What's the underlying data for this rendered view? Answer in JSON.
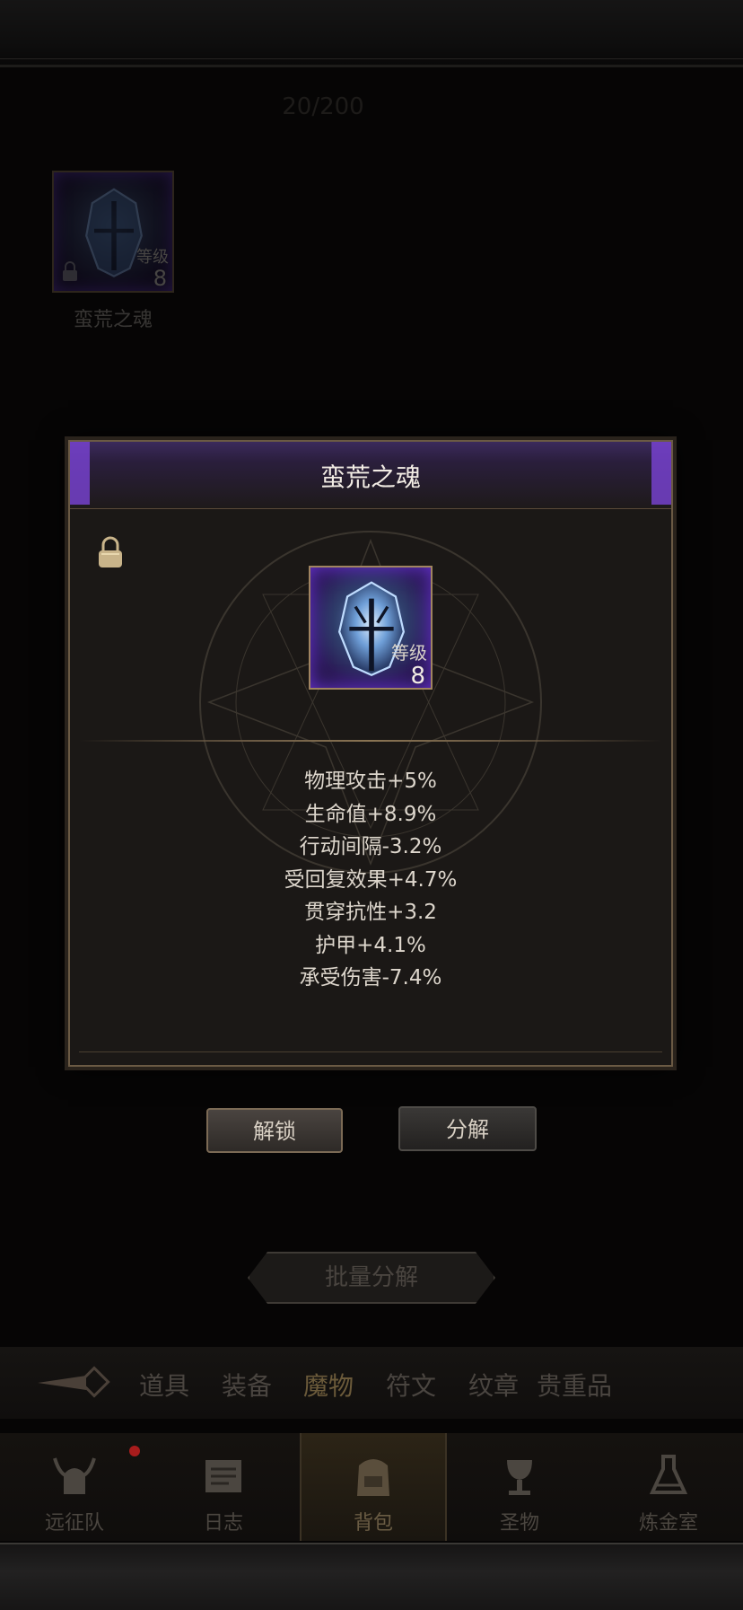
{
  "inventory": {
    "capacity": "20/200",
    "items": [
      {
        "name": "蛮荒之魂",
        "level_label": "等级",
        "level": "8"
      }
    ]
  },
  "modal": {
    "title": "蛮荒之魂",
    "level_label": "等级",
    "level": "8",
    "stats": [
      "物理攻击+5%",
      "生命值+8.9%",
      "行动间隔-3.2%",
      "受回复效果+4.7%",
      "贯穿抗性+3.2",
      "护甲+4.1%",
      "承受伤害-7.4%"
    ],
    "unlock_label": "解锁",
    "decompose_label": "分解"
  },
  "batch_decompose_label": "批量分解",
  "categories": [
    "道具",
    "装备",
    "魔物",
    "符文",
    "纹章",
    "贵重品"
  ],
  "active_category": "魔物",
  "nav": [
    {
      "label": "远征队",
      "icon": "horned-helmet-icon"
    },
    {
      "label": "日志",
      "icon": "scroll-icon"
    },
    {
      "label": "背包",
      "icon": "backpack-icon"
    },
    {
      "label": "圣物",
      "icon": "chalice-icon"
    },
    {
      "label": "炼金室",
      "icon": "alchemy-icon"
    }
  ],
  "active_nav": "背包",
  "colors": {
    "rarity_purple": "#7b43d6",
    "text_light": "#ddd6cc",
    "gold_border": "#a08460"
  }
}
